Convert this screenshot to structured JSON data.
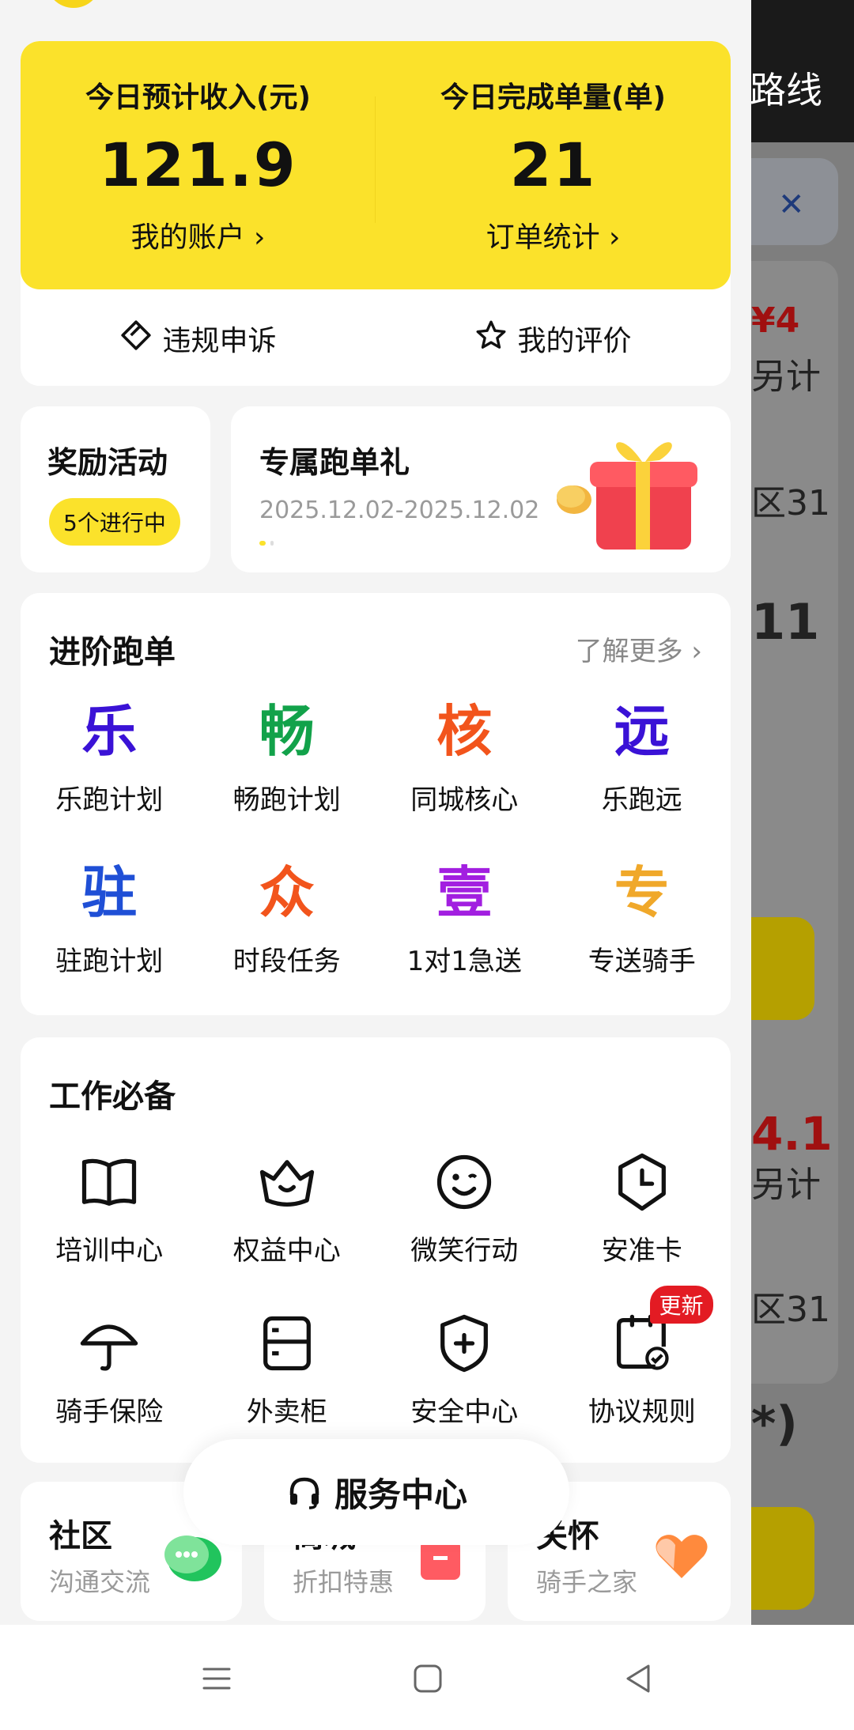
{
  "background": {
    "topbar_text": "路线",
    "texts": [
      "¥4",
      "另计",
      "区31",
      "11",
      "4.1",
      "另计",
      "区31",
      "*)"
    ]
  },
  "stats": {
    "income_label": "今日预计收入(元)",
    "income_value": "121.9",
    "account_link": "我的账户 ›",
    "orders_label": "今日完成单量(单)",
    "orders_value": "21",
    "orders_link": "订单统计 ›"
  },
  "quick_actions": {
    "appeal": "违规申诉",
    "rating": "我的评价"
  },
  "reward": {
    "title": "奖励活动",
    "badge": "5个进行中"
  },
  "gift": {
    "title": "专属跑单礼",
    "date_range": "2025.12.02-2025.12.02"
  },
  "advanced": {
    "title": "进阶跑单",
    "more": "了解更多 ›",
    "items": [
      {
        "glyph": "乐",
        "label": "乐跑计划",
        "color": "#3a12d6"
      },
      {
        "glyph": "畅",
        "label": "畅跑计划",
        "color": "#12a24a"
      },
      {
        "glyph": "核",
        "label": "同城核心",
        "color": "#f2541c"
      },
      {
        "glyph": "远",
        "label": "乐跑远",
        "color": "#3a12d6"
      },
      {
        "glyph": "驻",
        "label": "驻跑计划",
        "color": "#1f4fd6"
      },
      {
        "glyph": "众",
        "label": "时段任务",
        "color": "#f2541c"
      },
      {
        "glyph": "壹",
        "label": "1对1急送",
        "color": "#a21fe0"
      },
      {
        "glyph": "专",
        "label": "专送骑手",
        "color": "#f0a82a"
      }
    ]
  },
  "work": {
    "title": "工作必备",
    "items": [
      {
        "icon": "book-icon",
        "label": "培训中心"
      },
      {
        "icon": "crown-icon",
        "label": "权益中心"
      },
      {
        "icon": "smile-icon",
        "label": "微笑行动"
      },
      {
        "icon": "clock-shield-icon",
        "label": "安准卡"
      },
      {
        "icon": "umbrella-icon",
        "label": "骑手保险"
      },
      {
        "icon": "locker-icon",
        "label": "外卖柜"
      },
      {
        "icon": "shield-plus-icon",
        "label": "安全中心"
      },
      {
        "icon": "agreement-icon",
        "label": "协议规则",
        "badge": "更新"
      }
    ]
  },
  "bottom": {
    "community_title": "社区",
    "community_sub": "沟通交流",
    "mall_title": "商城",
    "mall_sub": "折扣特惠",
    "care_title": "关怀",
    "care_sub": "骑手之家"
  },
  "service": {
    "label": "服务中心"
  },
  "colors": {
    "brand_yellow": "#fbe22b",
    "badge_red": "#e31b23"
  }
}
